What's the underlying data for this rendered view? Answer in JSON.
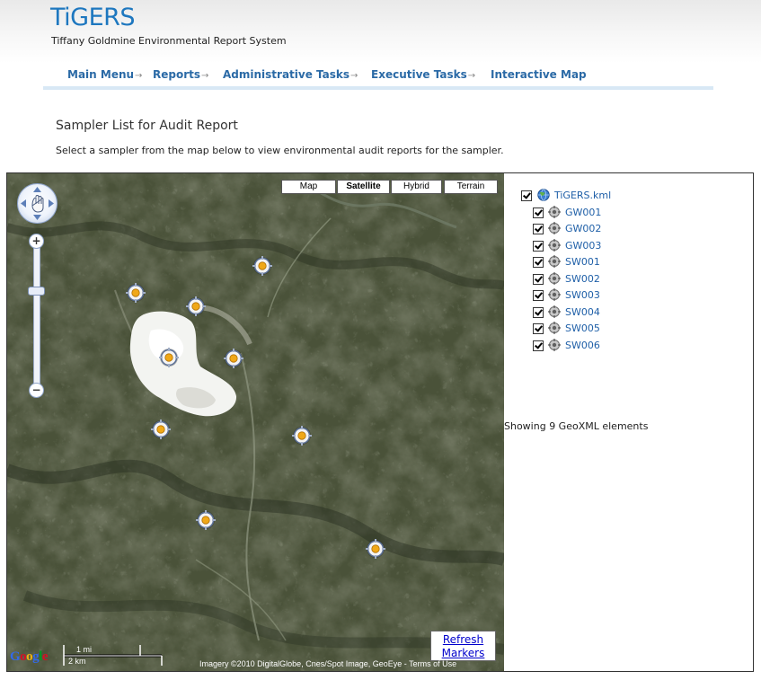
{
  "header": {
    "brand": "TiGERS",
    "subtitle": "Tiffany Goldmine Environmental Report System"
  },
  "nav": {
    "items": [
      {
        "label": "Main Menu",
        "arrow": "→"
      },
      {
        "label": "Reports",
        "arrow": "→"
      },
      {
        "label": "Administrative Tasks",
        "arrow": "→"
      },
      {
        "label": "Executive Tasks",
        "arrow": "→"
      },
      {
        "label": "Interactive Map",
        "arrow": ""
      }
    ]
  },
  "main": {
    "title": "Sampler List for Audit Report",
    "description": "Select a sampler from the map below to view environmental audit reports for the sampler."
  },
  "map": {
    "map_types": [
      "Map",
      "Satellite",
      "Hybrid",
      "Terrain"
    ],
    "active_map_type": "Satellite",
    "refresh_line1": "Refresh",
    "refresh_line2": "Markers",
    "google_logo": [
      "G",
      "o",
      "o",
      "g",
      "l",
      "e"
    ],
    "google_colors": [
      "#3369e8",
      "#d50f25",
      "#eeb211",
      "#3369e8",
      "#009925",
      "#d50f25"
    ],
    "scale_mi": "1 mi",
    "scale_km": "2 km",
    "copyright": "Imagery ©2010 DigitalGlobe, Cnes/Spot Image, GeoEye - Terms of Use",
    "marker_count": 9
  },
  "tree": {
    "root": {
      "label": "TiGERS.kml",
      "checked": true
    },
    "items": [
      {
        "label": "GW001",
        "checked": true
      },
      {
        "label": "GW002",
        "checked": true
      },
      {
        "label": "GW003",
        "checked": true
      },
      {
        "label": "SW001",
        "checked": true
      },
      {
        "label": "SW002",
        "checked": true
      },
      {
        "label": "SW003",
        "checked": true
      },
      {
        "label": "SW004",
        "checked": true
      },
      {
        "label": "SW005",
        "checked": true
      },
      {
        "label": "SW006",
        "checked": true
      }
    ],
    "status": "Showing 9 GeoXML elements"
  },
  "colors": {
    "brand": "#1d77bf",
    "nav_link": "#2b6aa6",
    "tree_link": "#2060a8",
    "marker_core": "#f0a818"
  }
}
